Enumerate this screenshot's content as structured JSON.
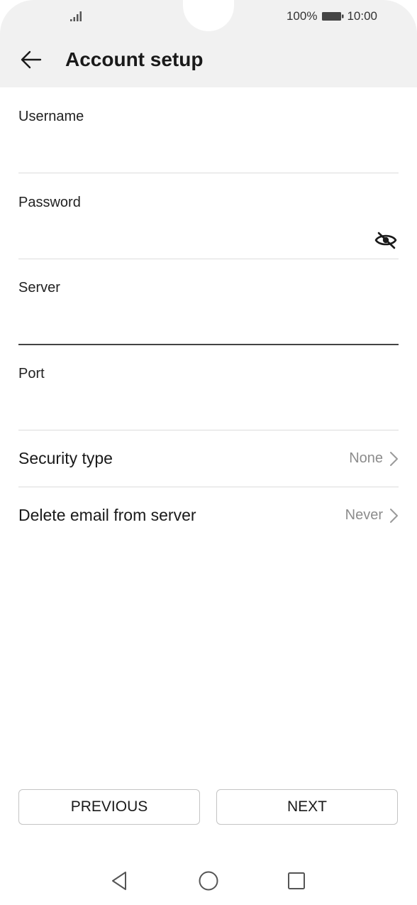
{
  "status_bar": {
    "battery_percent": "100%",
    "time": "10:00",
    "icons": [
      "signal-icon",
      "battery-icon"
    ]
  },
  "header": {
    "title": "Account setup",
    "back_icon": "arrow-left-icon"
  },
  "form": {
    "username": {
      "label": "Username",
      "value": "",
      "placeholder": ""
    },
    "password": {
      "label": "Password",
      "value": "",
      "placeholder": "",
      "toggle_icon": "eye-off-icon"
    },
    "server": {
      "label": "Server",
      "value": "",
      "placeholder": ""
    },
    "port": {
      "label": "Port",
      "value": "",
      "placeholder": ""
    }
  },
  "settings": {
    "security_type": {
      "label": "Security type",
      "value": "None"
    },
    "delete_email": {
      "label": "Delete email from server",
      "value": "Never"
    }
  },
  "buttons": {
    "previous": "PREVIOUS",
    "next": "NEXT"
  },
  "navbar": {
    "icons": [
      "back-triangle-icon",
      "home-circle-icon",
      "recents-square-icon"
    ]
  },
  "colors": {
    "header_bg": "#f1f1f1",
    "divider": "#dcdcdc",
    "focused_underline": "#444444",
    "secondary_text": "#8c8c8c"
  }
}
